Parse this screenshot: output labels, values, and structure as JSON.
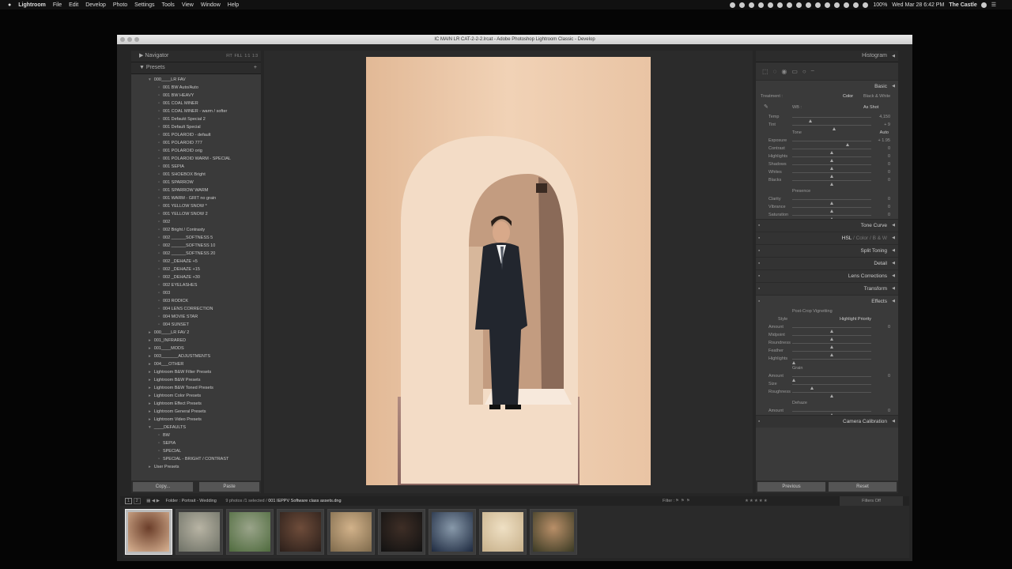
{
  "menubar": {
    "apple": "",
    "items": [
      "Lightroom",
      "File",
      "Edit",
      "Develop",
      "Photo",
      "Settings",
      "Tools",
      "View",
      "Window",
      "Help"
    ],
    "battery": "100%",
    "datetime": "Wed Mar 28  6:42 PM",
    "user": "The Castle"
  },
  "window": {
    "title": "IC MAIN LR CAT-2-2-2.lrcat - Adobe Photoshop Lightroom Classic - Develop"
  },
  "left_panel": {
    "navigator": "Navigator",
    "zoom_options": [
      "FIT",
      "FILL",
      "1:1",
      "1:3"
    ],
    "presets_title": "Presets",
    "add": "+",
    "copy_label": "Copy...",
    "paste_label": "Paste",
    "folders": [
      {
        "name": "000____LR FAV",
        "open": true
      },
      {
        "name": "000____LR FAV 2",
        "open": false
      },
      {
        "name": "001_INFRARED",
        "open": false
      },
      {
        "name": "001____MODS",
        "open": false
      },
      {
        "name": "003_______ADJUSTMENTS",
        "open": false
      },
      {
        "name": "004___OTHER",
        "open": false
      },
      {
        "name": "Lightroom B&W Filter Presets",
        "open": false
      },
      {
        "name": "Lightroom B&W Presets",
        "open": false
      },
      {
        "name": "Lightroom B&W Toned Presets",
        "open": false
      },
      {
        "name": "Lightroom Color Presets",
        "open": false
      },
      {
        "name": "Lightroom Effect Presets",
        "open": false
      },
      {
        "name": "Lightroom General Presets",
        "open": false
      },
      {
        "name": "Lightroom Video Presets",
        "open": false
      },
      {
        "name": "____DEFAULTS",
        "open": true
      },
      {
        "name": "User Presets",
        "open": false
      }
    ],
    "fav_presets": [
      "001   BW Auto/Auto",
      "001   BW HEAVY",
      "001   COAL MINER",
      "001   COAL MINER - warm / softer",
      "001   Defaukt Special 2",
      "001   Default Special",
      "001   POLAROID - default",
      "001   POLAROID 777",
      "001   POLAROID orig",
      "001   POLAROID WARM - SPECIAL",
      "001   SEPIA",
      "001   SHOEBOX Bright",
      "001   SPARROW",
      "001   SPARROW WARM",
      "001   WARM - GRIT no grain",
      "001   YELLOW SNOW *",
      "001   YELLOW SNOW 2",
      "002",
      "002   Bright / Contrasty",
      "002   ______SOFTNESS 5",
      "002   ______SOFTNESS 10",
      "002   ______SOFTNESS 20",
      "002   _DEHAZE  +5",
      "002   _DEHAZE  +15",
      "002   _DEHAZE  +30",
      "002   EYELASHES",
      "003",
      "003   RODICK",
      "004   LENS CORRECTION",
      "004   MOVIE STAR",
      "004   SUNSET"
    ],
    "default_presets": [
      "BW",
      "SEPIA",
      "SPECIAL",
      "SPECIAL - BRIGHT / CONTRAST"
    ]
  },
  "right_panel": {
    "histogram": "Histogram",
    "basic": "Basic",
    "treatment_label": "Treatment :",
    "treatment_color": "Color",
    "treatment_bw": "Black & White",
    "wb_label": "WB :",
    "wb_value": "As Shot",
    "tone_label": "Tone",
    "tone_auto": "Auto",
    "presence_label": "Presence",
    "sliders_wb": [
      {
        "label": "Temp",
        "value": "4,150",
        "pos": 0.23
      },
      {
        "label": "Tint",
        "value": "+ 9",
        "pos": 0.53
      }
    ],
    "sliders_tone": [
      {
        "label": "Exposure",
        "value": "+ 1.95",
        "pos": 0.7
      },
      {
        "label": "Contrast",
        "value": "0",
        "pos": 0.5
      },
      {
        "label": "Highlights",
        "value": "0",
        "pos": 0.5
      },
      {
        "label": "Shadows",
        "value": "0",
        "pos": 0.5
      },
      {
        "label": "Whites",
        "value": "0",
        "pos": 0.5
      },
      {
        "label": "Blacks",
        "value": "0",
        "pos": 0.5
      }
    ],
    "sliders_presence": [
      {
        "label": "Clarity",
        "value": "0",
        "pos": 0.5
      },
      {
        "label": "Vibrance",
        "value": "0",
        "pos": 0.5
      },
      {
        "label": "Saturation",
        "value": "0",
        "pos": 0.5
      }
    ],
    "sections": [
      "Tone Curve",
      "Split Toning",
      "Detail",
      "Lens Corrections",
      "Transform",
      "Effects"
    ],
    "hsl": [
      "HSL",
      "/",
      "Color",
      "/",
      "B & W"
    ],
    "post_crop": "Post-Crop Vignetting",
    "style_label": "Style",
    "style_value": "Highlight Priority",
    "sliders_vignette": [
      {
        "label": "Amount",
        "value": "0",
        "pos": 0.5
      },
      {
        "label": "Midpoint",
        "value": "",
        "pos": 0.5
      },
      {
        "label": "Roundness",
        "value": "",
        "pos": 0.5
      },
      {
        "label": "Feather",
        "value": "",
        "pos": 0.5
      },
      {
        "label": "Highlights",
        "value": "",
        "pos": 0.02
      }
    ],
    "grain": "Grain",
    "sliders_grain": [
      {
        "label": "Amount",
        "value": "0",
        "pos": 0.02
      },
      {
        "label": "Size",
        "value": "",
        "pos": 0.25
      },
      {
        "label": "Roughness",
        "value": "",
        "pos": 0.5
      }
    ],
    "dehaze": "Dehaze",
    "sliders_dehaze": [
      {
        "label": "Amount",
        "value": "0",
        "pos": 0.5
      }
    ],
    "camera_calibration": "Camera Calibration",
    "previous": "Previous",
    "reset": "Reset"
  },
  "filmstrip": {
    "pages": [
      "1",
      "2"
    ],
    "folder_info": "Folder : Portrait - Wedding",
    "count": "9 photos /1 selected /",
    "filename": "001 IEPPV Software class assets.dng",
    "filter_label": "Filter :",
    "filter_value": "Filters Off",
    "thumbs": [
      {
        "selected": true,
        "c1": "#d9b393",
        "c2": "#6b3e2a"
      },
      {
        "selected": false,
        "c1": "#6e7166",
        "c2": "#b8b4a4"
      },
      {
        "selected": false,
        "c1": "#4f6b3e",
        "c2": "#9aa48a"
      },
      {
        "selected": false,
        "c1": "#2b1f1a",
        "c2": "#6e4c3a"
      },
      {
        "selected": false,
        "c1": "#7e6a4c",
        "c2": "#d2b28a"
      },
      {
        "selected": false,
        "c1": "#111111",
        "c2": "#3e2e26"
      },
      {
        "selected": false,
        "c1": "#1e2a40",
        "c2": "#8899aa"
      },
      {
        "selected": false,
        "c1": "#c7b08a",
        "c2": "#efe0c4"
      },
      {
        "selected": false,
        "c1": "#3a3a24",
        "c2": "#b98f68"
      }
    ]
  }
}
